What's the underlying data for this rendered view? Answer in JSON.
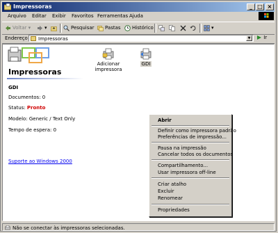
{
  "window": {
    "title": "Impressoras"
  },
  "menu": [
    "Arquivo",
    "Editar",
    "Exibir",
    "Favoritos",
    "Ferramentas",
    "Ajuda"
  ],
  "toolbar": {
    "back": "Voltar",
    "search": "Pesquisar",
    "folders": "Pastas",
    "history": "Histórico"
  },
  "address": {
    "label": "Endereço",
    "value": "Impressoras",
    "go": "Ir"
  },
  "pane": {
    "title": "Impressoras",
    "printer_name": "GDI",
    "documents": "Documentos: 0",
    "status_label": "Status:",
    "status_value": "Pronto",
    "model": "Modelo: Generic / Text Only",
    "wait": "Tempo de espera: 0",
    "support_link": "Suporte ao Windows 2000"
  },
  "icons": [
    {
      "label": "Adicionar impressora"
    },
    {
      "label": "GDI"
    }
  ],
  "context_menu": {
    "open": "Abrir",
    "set_default": "Definir como impressora padrão",
    "preferences": "Preferências de impressão...",
    "pause": "Pausa na impressão",
    "cancel_all": "Cancelar todos os documentos",
    "sharing": "Compartilhamento...",
    "offline": "Usar impressora off-line",
    "shortcut": "Criar atalho",
    "delete": "Excluir",
    "rename": "Renomear",
    "properties": "Propriedades"
  },
  "statusbar": {
    "text": "Não se conectar às impressoras selecionadas."
  },
  "colors": {
    "title_start": "#0a246a",
    "title_end": "#a6caf0",
    "status_ready": "#d00000",
    "link": "#0000ee"
  }
}
